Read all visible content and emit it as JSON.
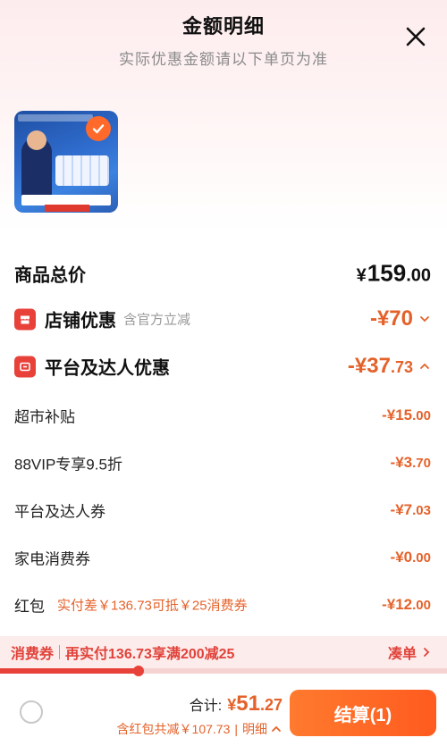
{
  "header": {
    "title": "金额明细",
    "subtitle": "实际优惠金额请以下单页为准"
  },
  "product": {
    "thumbnail": "beer-product-thumbnail",
    "selected": true
  },
  "summary": {
    "total_label": "商品总价",
    "total_currency": "¥",
    "total_int": "159",
    "total_dec": ".00"
  },
  "store_discount": {
    "label": "店铺优惠",
    "note": "含官方立减",
    "amount_prefix": "-¥",
    "amount_int": "70",
    "amount_dec": ""
  },
  "platform_discount": {
    "label": "平台及达人优惠",
    "amount_prefix": "-¥",
    "amount_int": "37",
    "amount_dec": ".73",
    "items": [
      {
        "label": "超市补贴",
        "note": "",
        "prefix": "-¥",
        "int": "15",
        "dec": ".00"
      },
      {
        "label": "88VIP专享9.5折",
        "note": "",
        "prefix": "-¥",
        "int": "3",
        "dec": ".70"
      },
      {
        "label": "平台及达人券",
        "note": "",
        "prefix": "-¥",
        "int": "7",
        "dec": ".03"
      },
      {
        "label": "家电消费券",
        "note": "",
        "prefix": "-¥",
        "int": "0",
        "dec": ".00"
      },
      {
        "label": "红包",
        "note": "实付差￥136.73可抵￥25消费券",
        "prefix": "-¥",
        "int": "12",
        "dec": ".00"
      }
    ]
  },
  "promo": {
    "tag": "消费券",
    "text": "再实付136.73享满200减25",
    "link": "凑单",
    "progress": 0.31
  },
  "footer": {
    "total_label": "合计:",
    "total_currency": "¥",
    "total_int": "51",
    "total_dec": ".27",
    "detail_text": "含红包共减￥107.73",
    "detail_sep": "|",
    "detail_link": "明细",
    "checkout_label": "结算(1)"
  },
  "colors": {
    "accent": "#e4622a",
    "red": "#e8413a",
    "checkout_start": "#ff7a2e",
    "checkout_end": "#ff5b1f"
  }
}
